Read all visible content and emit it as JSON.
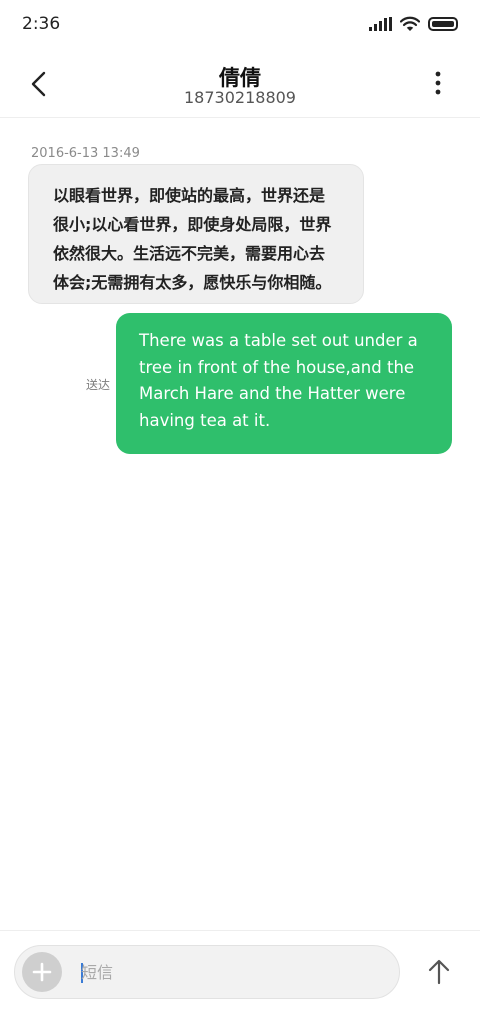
{
  "status_bar": {
    "time": "2:36",
    "icons": [
      "signal-icon",
      "wifi-icon",
      "battery-icon"
    ]
  },
  "header": {
    "contact_name": "倩倩",
    "contact_number": "18730218809",
    "back_icon": "chevron-left-icon",
    "menu_icon": "more-vertical-icon"
  },
  "conversation": {
    "timestamp": "2016-6-13 13:49",
    "incoming_lines": [
      "以眼看世界，即使站的最高，世界还是",
      "很小;以心看世界，即使身处局限，世界",
      "依然很大。生活远不完美，需要用心去",
      "体会;无需拥有太多，愿快乐与你相随。"
    ],
    "outgoing_lines": [
      "There was a table set out under a",
      "tree in front of the house,and the",
      "March Hare and the Hatter were",
      "having tea at it."
    ],
    "outgoing_status": "送达"
  },
  "composer": {
    "placeholder": "短信",
    "add_icon": "plus-icon",
    "send_icon": "arrow-up-icon"
  },
  "colors": {
    "outgoing_bubble": "#2fbf6c",
    "incoming_bubble": "#f0f0f0",
    "caret": "#3a7bd5"
  }
}
